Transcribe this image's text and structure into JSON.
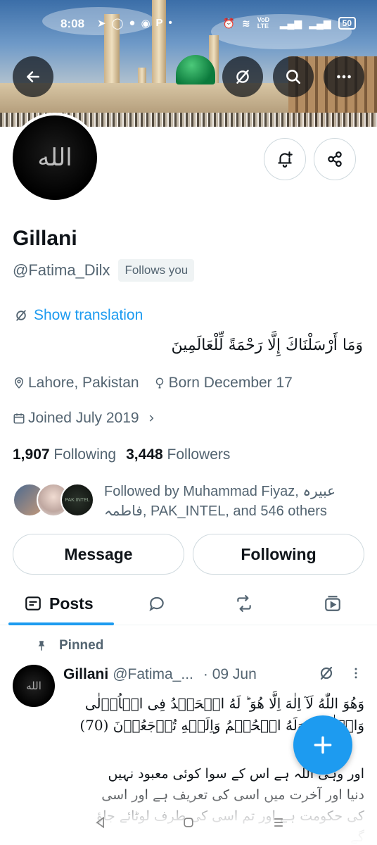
{
  "status_bar": {
    "time": "8:08",
    "left_icons": [
      "telegram-icon",
      "chat-icon",
      "messenger-icon",
      "whatsapp-icon",
      "p-icon",
      "dot-icon"
    ],
    "p_label": "P",
    "net_label": "VoD LTE",
    "battery": "50"
  },
  "profile": {
    "name": "Gillani",
    "handle": "@Fatima_Dilx",
    "follows_you": "Follows you",
    "show_translation": "Show translation",
    "bio": "وَمَا أَرْسَلْنَاكَ إِلَّا رَحْمَةً لِّلْعَالَمِينَ",
    "location": "Lahore, Pakistan",
    "birthday": "Born December 17",
    "joined": "Joined July 2019",
    "following_count": "1,907",
    "following_label": "Following",
    "followers_count": "3,448",
    "followers_label": "Followers",
    "followed_by": "Followed by Muhammad Fiyaz, عبیرہ فاطمہ, PAK_INTEL, and 546 others",
    "mini_avatar_text": "PAK INTEL",
    "avatar_text": "الله"
  },
  "buttons": {
    "message": "Message",
    "following": "Following"
  },
  "tabs": [
    {
      "label": "Posts",
      "icon": "posts-icon"
    },
    {
      "label": "",
      "icon": "replies-icon"
    },
    {
      "label": "",
      "icon": "reposts-icon"
    },
    {
      "label": "",
      "icon": "media-icon"
    }
  ],
  "pinned_post": {
    "pinned_label": "Pinned",
    "author": "Gillani",
    "handle": "@Fatima_...",
    "date": "· 09 Jun",
    "avatar_text": "الله",
    "arabic_text": "وَهُوَ اللّٰهُ لَآ اِلٰهَ اِلَّا هُوَ ؕ لَهُ الۡحَمۡدُ فِى الۡاُوۡلٰى\nوَالۡاٰخِرَةِ وَلَهُ الۡحُكۡمُ وَاِلَيۡهِ تُرۡجَعُوۡنَ (70)",
    "urdu_text": "اور وہی اللہ ہے اس کے سوا کوئی معبود نہیں\nدنیا اور آخرت میں اسی کی تعریف ہے اور اسی\nکی حکومت ہے اور تم اسی کی طرف لوٹائے جاؤ\nگے"
  },
  "colors": {
    "accent": "#1d9bf0",
    "text": "#0f1419",
    "muted": "#536471",
    "border": "#cfd9de"
  }
}
